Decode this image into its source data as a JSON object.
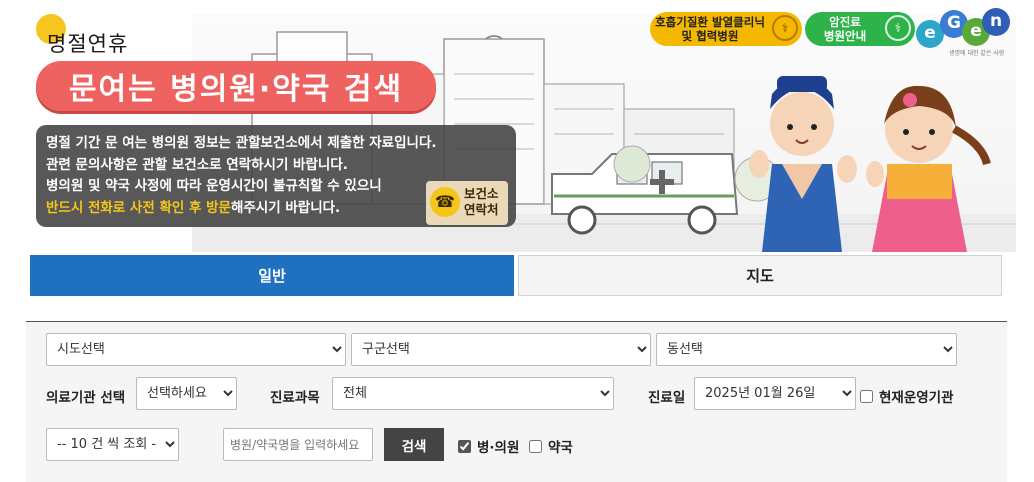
{
  "banner": {
    "holiday_label": "명절연휴",
    "title": "문여는 병의원·약국 검색",
    "notice_lines": [
      "명절 기간 문 여는 병의원 정보는 관할보건소에서 제출한 자료입니다.",
      "관련 문의사항은 관할 보건소로 연락하시기 바랍니다.",
      "병의원 및 약국 사정에 따라 운영시간이 불규칙할 수 있으니"
    ],
    "notice_highlight": "반드시 전화로 사전 확인 후 방문",
    "notice_tail": "해주시기 바랍니다.",
    "call_button": {
      "line1": "보건소",
      "line2": "연락처",
      "icon": "phone-icon"
    },
    "link_fever": {
      "line1": "호흡기질환 발열클리닉",
      "line2": "및 협력병원",
      "icon": "stethoscope-icon",
      "color": "#f5b800"
    },
    "link_cancer": {
      "line1": "암진료",
      "line2": "병원안내",
      "icon": "stethoscope-icon",
      "color": "#2db34a"
    },
    "logo": {
      "letters": [
        "e",
        "G",
        "e",
        "n"
      ],
      "tagline": "생명에 대한 같은 사랑"
    }
  },
  "tabs": [
    {
      "label": "일반",
      "active": true
    },
    {
      "label": "지도",
      "active": false
    }
  ],
  "form": {
    "sido": {
      "value": "시도선택"
    },
    "gugun": {
      "value": "구군선택"
    },
    "dong": {
      "value": "동선택"
    },
    "org_type": {
      "label": "의료기관 선택",
      "value": "선택하세요"
    },
    "dept": {
      "label": "진료과목",
      "value": "전체"
    },
    "date": {
      "label": "진료일",
      "value": "2025년 01월 26일"
    },
    "now_open": {
      "label": "현재운영기관",
      "checked": false
    },
    "page_size": {
      "value": "-- 10 건 씩 조회 --"
    },
    "keyword": {
      "placeholder": "병원/약국명을 입력하세요",
      "value": ""
    },
    "search_button": "검색",
    "hospital": {
      "label": "병·의원",
      "checked": true
    },
    "pharmacy": {
      "label": "약국",
      "checked": false
    }
  },
  "colors": {
    "accent": "#1f70bf",
    "title_pill": "#ee6360",
    "highlight": "#f5c518"
  }
}
